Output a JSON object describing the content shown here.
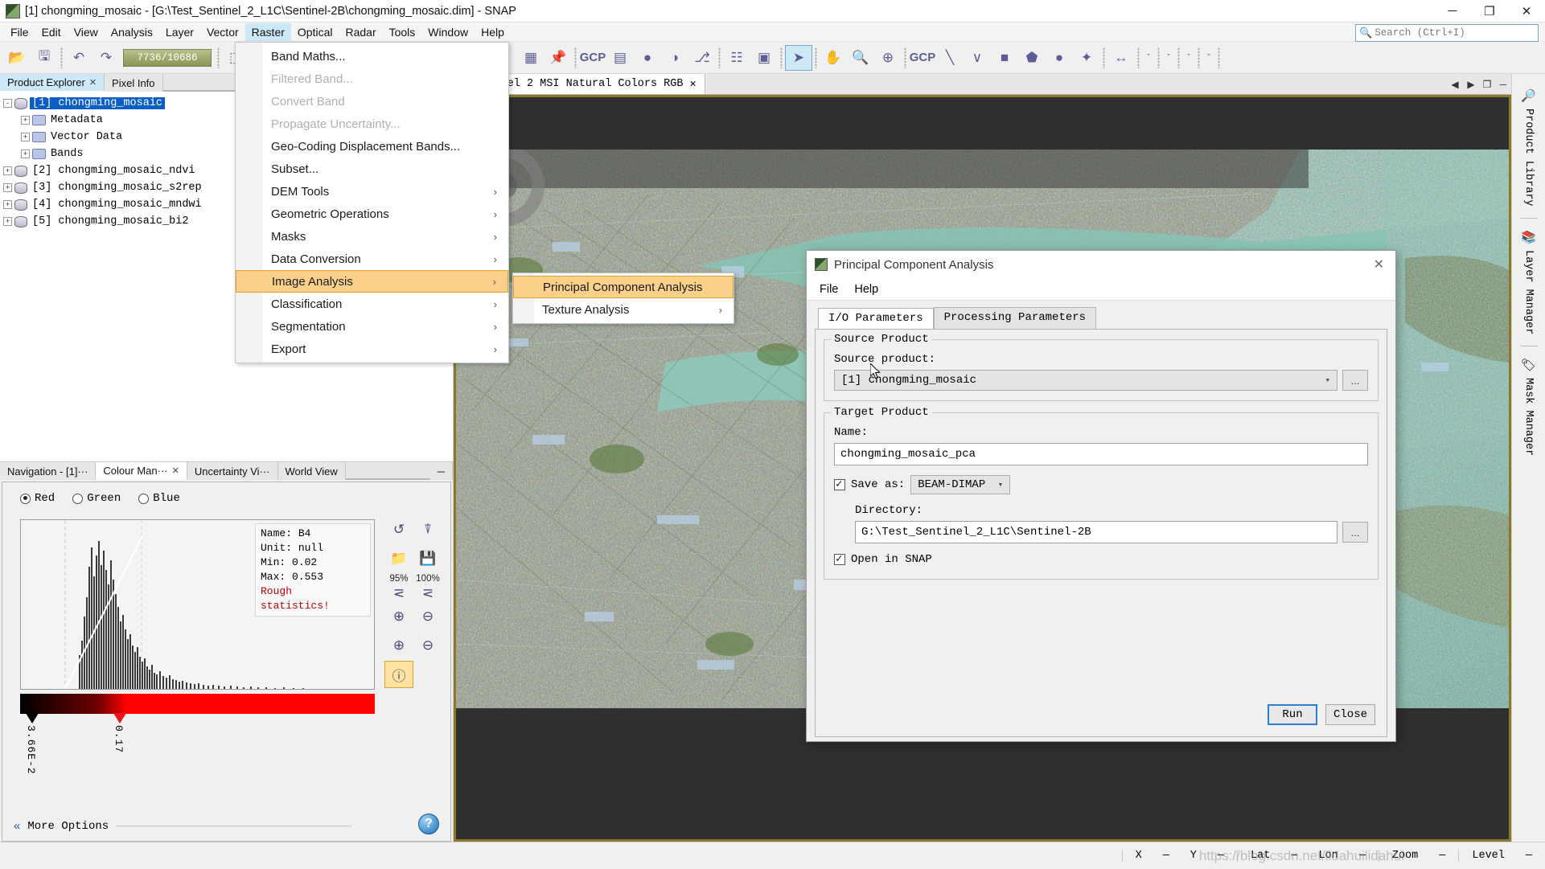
{
  "window": {
    "title": "[1] chongming_mosaic - [G:\\Test_Sentinel_2_L1C\\Sentinel-2B\\chongming_mosaic.dim] - SNAP",
    "minimize": "─",
    "maximize": "❐",
    "close": "✕"
  },
  "menubar": {
    "items": [
      {
        "label": "File"
      },
      {
        "label": "Edit"
      },
      {
        "label": "View"
      },
      {
        "label": "Analysis"
      },
      {
        "label": "Layer"
      },
      {
        "label": "Vector"
      },
      {
        "label": "Raster",
        "active": true
      },
      {
        "label": "Optical"
      },
      {
        "label": "Radar"
      },
      {
        "label": "Tools"
      },
      {
        "label": "Window"
      },
      {
        "label": "Help"
      }
    ]
  },
  "search": {
    "icon": "search-icon",
    "placeholder": "Search (Ctrl+I)"
  },
  "toolbar": {
    "memory_value": "7736/10686",
    "icons": [
      "open-product-icon",
      "save-product-icon",
      "undo-icon",
      "redo-icon",
      "reopen-icon",
      "pin-icon",
      "geo-coding-icon",
      "histogram-icon",
      "information-icon",
      "colour-manipulation-icon",
      "profile-plot-icon",
      "scatter-plot-icon",
      "statistics-icon",
      "no-data-overlay-icon",
      "graticule-overlay-icon",
      "pin-overlay-icon",
      "geometry-overlay-icon",
      "grid-overlay-icon",
      "gcp-overlay-icon",
      "mask-overlay-icon",
      "graph-builder-icon",
      "batch-processing-icon",
      "subset-icon",
      "select-tool-icon",
      "pan-tool-icon",
      "zoom-tool-icon",
      "pin-placing-tool-icon",
      "gcp-placing-tool-icon",
      "line-drawing-icon",
      "polyline-drawing-icon",
      "rectangle-drawing-icon",
      "polygon-drawing-icon",
      "ellipse-drawing-icon",
      "magic-wand-icon",
      "range-finder-icon"
    ]
  },
  "product_explorer": {
    "tabs": [
      {
        "label": "Product Explorer",
        "closable": true,
        "active": true
      },
      {
        "label": "Pixel Info",
        "closable": false,
        "active": false
      }
    ],
    "close_glyph": "✕",
    "tree": [
      {
        "label": "[1] chongming_mosaic",
        "depth": 0,
        "expander": "-",
        "icon": "product-icon",
        "selected": true
      },
      {
        "label": "Metadata",
        "depth": 1,
        "expander": "+",
        "icon": "folder-icon",
        "selected": false
      },
      {
        "label": "Vector Data",
        "depth": 1,
        "expander": "+",
        "icon": "folder-icon",
        "selected": false
      },
      {
        "label": "Bands",
        "depth": 1,
        "expander": "+",
        "icon": "folder-icon",
        "selected": false
      },
      {
        "label": "[2] chongming_mosaic_ndvi",
        "depth": 0,
        "expander": "+",
        "icon": "product-icon",
        "selected": false
      },
      {
        "label": "[3] chongming_mosaic_s2rep",
        "depth": 0,
        "expander": "+",
        "icon": "product-icon",
        "selected": false
      },
      {
        "label": "[4] chongming_mosaic_mndwi",
        "depth": 0,
        "expander": "+",
        "icon": "product-icon",
        "selected": false
      },
      {
        "label": "[5] chongming_mosaic_bi2",
        "depth": 0,
        "expander": "+",
        "icon": "product-icon",
        "selected": false
      }
    ]
  },
  "bottom_dock": {
    "tabs": [
      {
        "label": "Navigation - [1]···",
        "closable": false,
        "active": false
      },
      {
        "label": "Colour Man···",
        "closable": true,
        "active": true
      },
      {
        "label": "Uncertainty Vi···",
        "closable": false,
        "active": false
      },
      {
        "label": "World View",
        "closable": false,
        "active": false
      }
    ],
    "close_glyph": "✕",
    "minimize_glyph": "─",
    "channels": [
      {
        "label": "Red",
        "selected": true
      },
      {
        "label": "Green",
        "selected": false
      },
      {
        "label": "Blue",
        "selected": false
      }
    ],
    "stats": {
      "name_label": "Name:",
      "name_value": "B4",
      "unit_label": "Unit:",
      "unit_value": "null",
      "min_label": "Min:",
      "min_value": "0.02",
      "max_label": "Max:",
      "max_value": "0.553",
      "warning": "Rough statistics!"
    },
    "slider_labels": [
      "3.66E-2",
      "0.17"
    ],
    "tools": [
      {
        "name": "reset-icon",
        "glyph": "↺"
      },
      {
        "name": "multi-apply-icon",
        "glyph": "❐"
      },
      {
        "name": "import-palette-icon",
        "glyph": "▭"
      },
      {
        "name": "export-palette-icon",
        "glyph": "⬇"
      },
      {
        "name": "stretch-95-icon",
        "glyph": "⊥",
        "caption": "95%"
      },
      {
        "name": "stretch-100-icon",
        "glyph": "⊥",
        "caption": "100%"
      },
      {
        "name": "zoom-in-vertical-icon",
        "glyph": "⊕"
      },
      {
        "name": "zoom-out-vertical-icon",
        "glyph": "⊖"
      },
      {
        "name": "zoom-in-horizontal-icon",
        "glyph": "⊕"
      },
      {
        "name": "zoom-out-horizontal-icon",
        "glyph": "⊖"
      },
      {
        "name": "show-extra-info-icon",
        "glyph": "ⓘ",
        "active": true
      }
    ],
    "more_options": "More Options",
    "more_options_chevron": "«",
    "help_glyph": "?"
  },
  "view": {
    "tab_label": "···ntinel 2 MSI Natural Colors RGB",
    "tab_close": "✕",
    "controls": [
      "◀",
      "▶",
      "❐",
      "─"
    ]
  },
  "right_tabs": [
    {
      "label": "Product Library",
      "icon": "product-library-icon"
    },
    {
      "label": "Layer Manager",
      "icon": "layer-manager-icon"
    },
    {
      "label": "Mask Manager",
      "icon": "mask-manager-icon"
    }
  ],
  "statusbar": {
    "x_label": "X",
    "x_value": "—",
    "y_label": "Y",
    "y_value": "—",
    "lat_label": "Lat",
    "lat_value": "—",
    "lon_label": "Lon",
    "lon_value": "—",
    "zoom_label": "Zoom",
    "zoom_value": "—",
    "level_label": "Level",
    "level_value": "—"
  },
  "watermark": "https://blog.csdn.net/lidahuilidahui",
  "raster_menu": {
    "items": [
      {
        "label": "Band Maths...",
        "disabled": false,
        "submenu": false,
        "highlight": false
      },
      {
        "label": "Filtered Band...",
        "disabled": true,
        "submenu": false,
        "highlight": false
      },
      {
        "label": "Convert Band",
        "disabled": true,
        "submenu": false,
        "highlight": false
      },
      {
        "label": "Propagate Uncertainty...",
        "disabled": true,
        "submenu": false,
        "highlight": false
      },
      {
        "label": "Geo-Coding Displacement Bands...",
        "disabled": false,
        "submenu": false,
        "highlight": false
      },
      {
        "label": "Subset...",
        "disabled": false,
        "submenu": false,
        "highlight": false
      },
      {
        "label": "DEM Tools",
        "disabled": false,
        "submenu": true,
        "highlight": false
      },
      {
        "label": "Geometric Operations",
        "disabled": false,
        "submenu": true,
        "highlight": false
      },
      {
        "label": "Masks",
        "disabled": false,
        "submenu": true,
        "highlight": false
      },
      {
        "label": "Data Conversion",
        "disabled": false,
        "submenu": true,
        "highlight": false
      },
      {
        "label": "Image Analysis",
        "disabled": false,
        "submenu": true,
        "highlight": true
      },
      {
        "label": "Classification",
        "disabled": false,
        "submenu": true,
        "highlight": false
      },
      {
        "label": "Segmentation",
        "disabled": false,
        "submenu": true,
        "highlight": false
      },
      {
        "label": "Export",
        "disabled": false,
        "submenu": true,
        "highlight": false
      }
    ],
    "submenu_arrow": "›"
  },
  "image_analysis_submenu": {
    "items": [
      {
        "label": "Principal Component Analysis",
        "submenu": false,
        "highlight": true
      },
      {
        "label": "Texture Analysis",
        "submenu": true,
        "highlight": false
      }
    ],
    "submenu_arrow": "›"
  },
  "pca_dialog": {
    "title": "Principal Component Analysis",
    "close_glyph": "✕",
    "menu": [
      {
        "label": "File"
      },
      {
        "label": "Help"
      }
    ],
    "tabs": [
      {
        "label": "I/O Parameters",
        "active": true
      },
      {
        "label": "Processing Parameters",
        "active": false
      }
    ],
    "source_group_title": "Source Product",
    "source_label": "Source product:",
    "source_value": "[1] chongming_mosaic",
    "source_browse": "...",
    "target_group_title": "Target Product",
    "name_label": "Name:",
    "name_value": "chongming_mosaic_pca",
    "save_as_label": "Save as:",
    "save_as_checked": true,
    "format_value": "BEAM-DIMAP",
    "directory_label": "Directory:",
    "directory_value": "G:\\Test_Sentinel_2_L1C\\Sentinel-2B",
    "directory_browse": "...",
    "open_in_snap_label": "Open in SNAP",
    "open_in_snap_checked": true,
    "run_label": "Run",
    "close_label": "Close"
  },
  "colors": {
    "accent": "#cde8f7",
    "selection": "#0a5fc4",
    "menu_highlight": "#fbd08a",
    "warning": "#c00000",
    "button_focus": "#2f7fd0",
    "view_border": "#8a7a28"
  }
}
